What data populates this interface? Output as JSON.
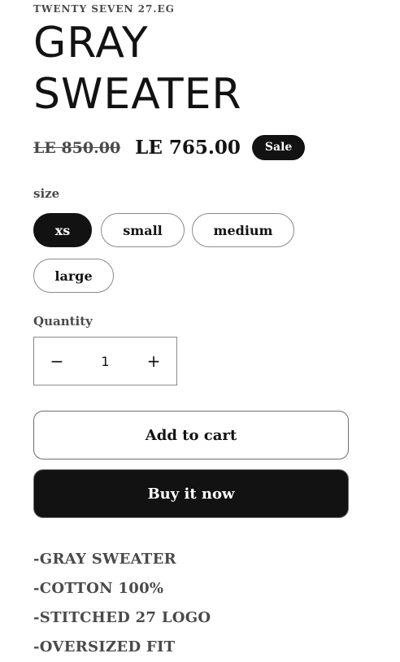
{
  "product": {
    "vendor": "TWENTY SEVEN 27.EG",
    "title_line1": "GRAY",
    "title_line2": "SWEATER",
    "price_regular": "LE 850.00",
    "price_sale": "LE 765.00",
    "badge": "Sale"
  },
  "size": {
    "label": "size",
    "options": [
      "xs",
      "small",
      "medium",
      "large"
    ],
    "selected": "xs"
  },
  "quantity": {
    "label": "Quantity",
    "value": "1",
    "minus_symbol": "−",
    "plus_symbol": "+"
  },
  "actions": {
    "add_to_cart": "Add to cart",
    "buy_now": "Buy it now"
  },
  "description": [
    "-GRAY SWEATER",
    "-COTTON 100%",
    "-STITCHED 27 LOGO",
    "-OVERSIZED FIT"
  ]
}
